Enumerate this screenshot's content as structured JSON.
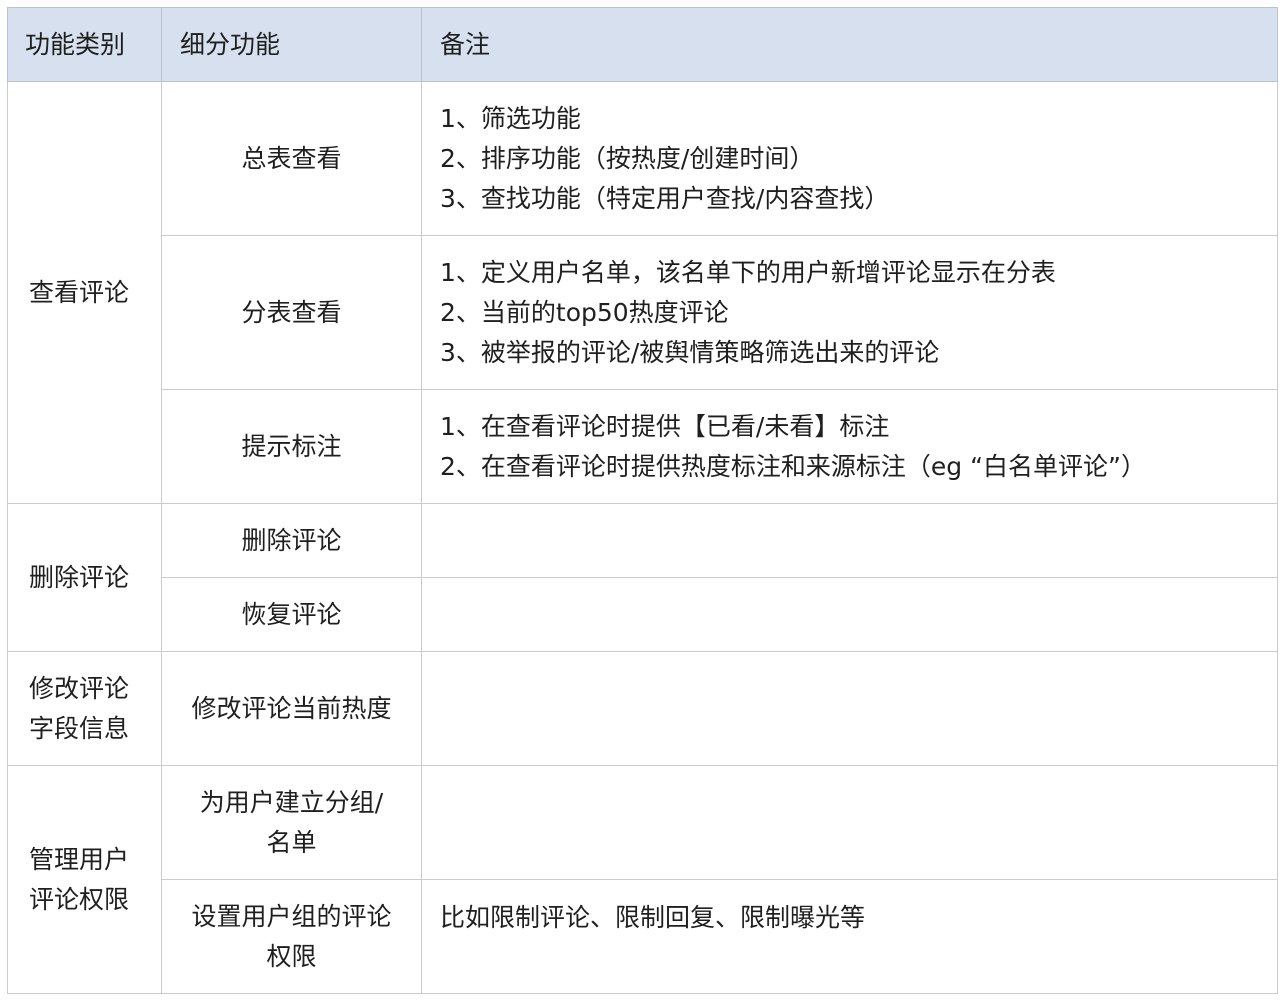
{
  "header": {
    "col1": "功能类别",
    "col2": "细分功能",
    "col3": "备注"
  },
  "groups": [
    {
      "category": "查看评论",
      "rows": [
        {
          "sub": "总表查看",
          "notes": [
            "1、筛选功能",
            "2、排序功能（按热度/创建时间）",
            "3、查找功能（特定用户查找/内容查找）"
          ]
        },
        {
          "sub": "分表查看",
          "notes": [
            "1、定义用户名单，该名单下的用户新增评论显示在分表",
            "2、当前的top50热度评论",
            "3、被举报的评论/被舆情策略筛选出来的评论"
          ]
        },
        {
          "sub": "提示标注",
          "notes": [
            "1、在查看评论时提供【已看/未看】标注",
            "2、在查看评论时提供热度标注和来源标注（eg “白名单评论”）"
          ]
        }
      ]
    },
    {
      "category": "删除评论",
      "rows": [
        {
          "sub": "删除评论",
          "notes": []
        },
        {
          "sub": "恢复评论",
          "notes": []
        }
      ]
    },
    {
      "category_lines": [
        "修改评论",
        "字段信息"
      ],
      "rows": [
        {
          "sub": "修改评论当前热度",
          "notes": []
        }
      ]
    },
    {
      "category_lines": [
        "管理用户",
        "评论权限"
      ],
      "rows": [
        {
          "sub_lines": [
            "为用户建立分组/",
            "名单"
          ],
          "notes": []
        },
        {
          "sub_lines": [
            "设置用户组的评论",
            "权限"
          ],
          "notes": [
            "比如限制评论、限制回复、限制曝光等"
          ]
        }
      ]
    }
  ]
}
